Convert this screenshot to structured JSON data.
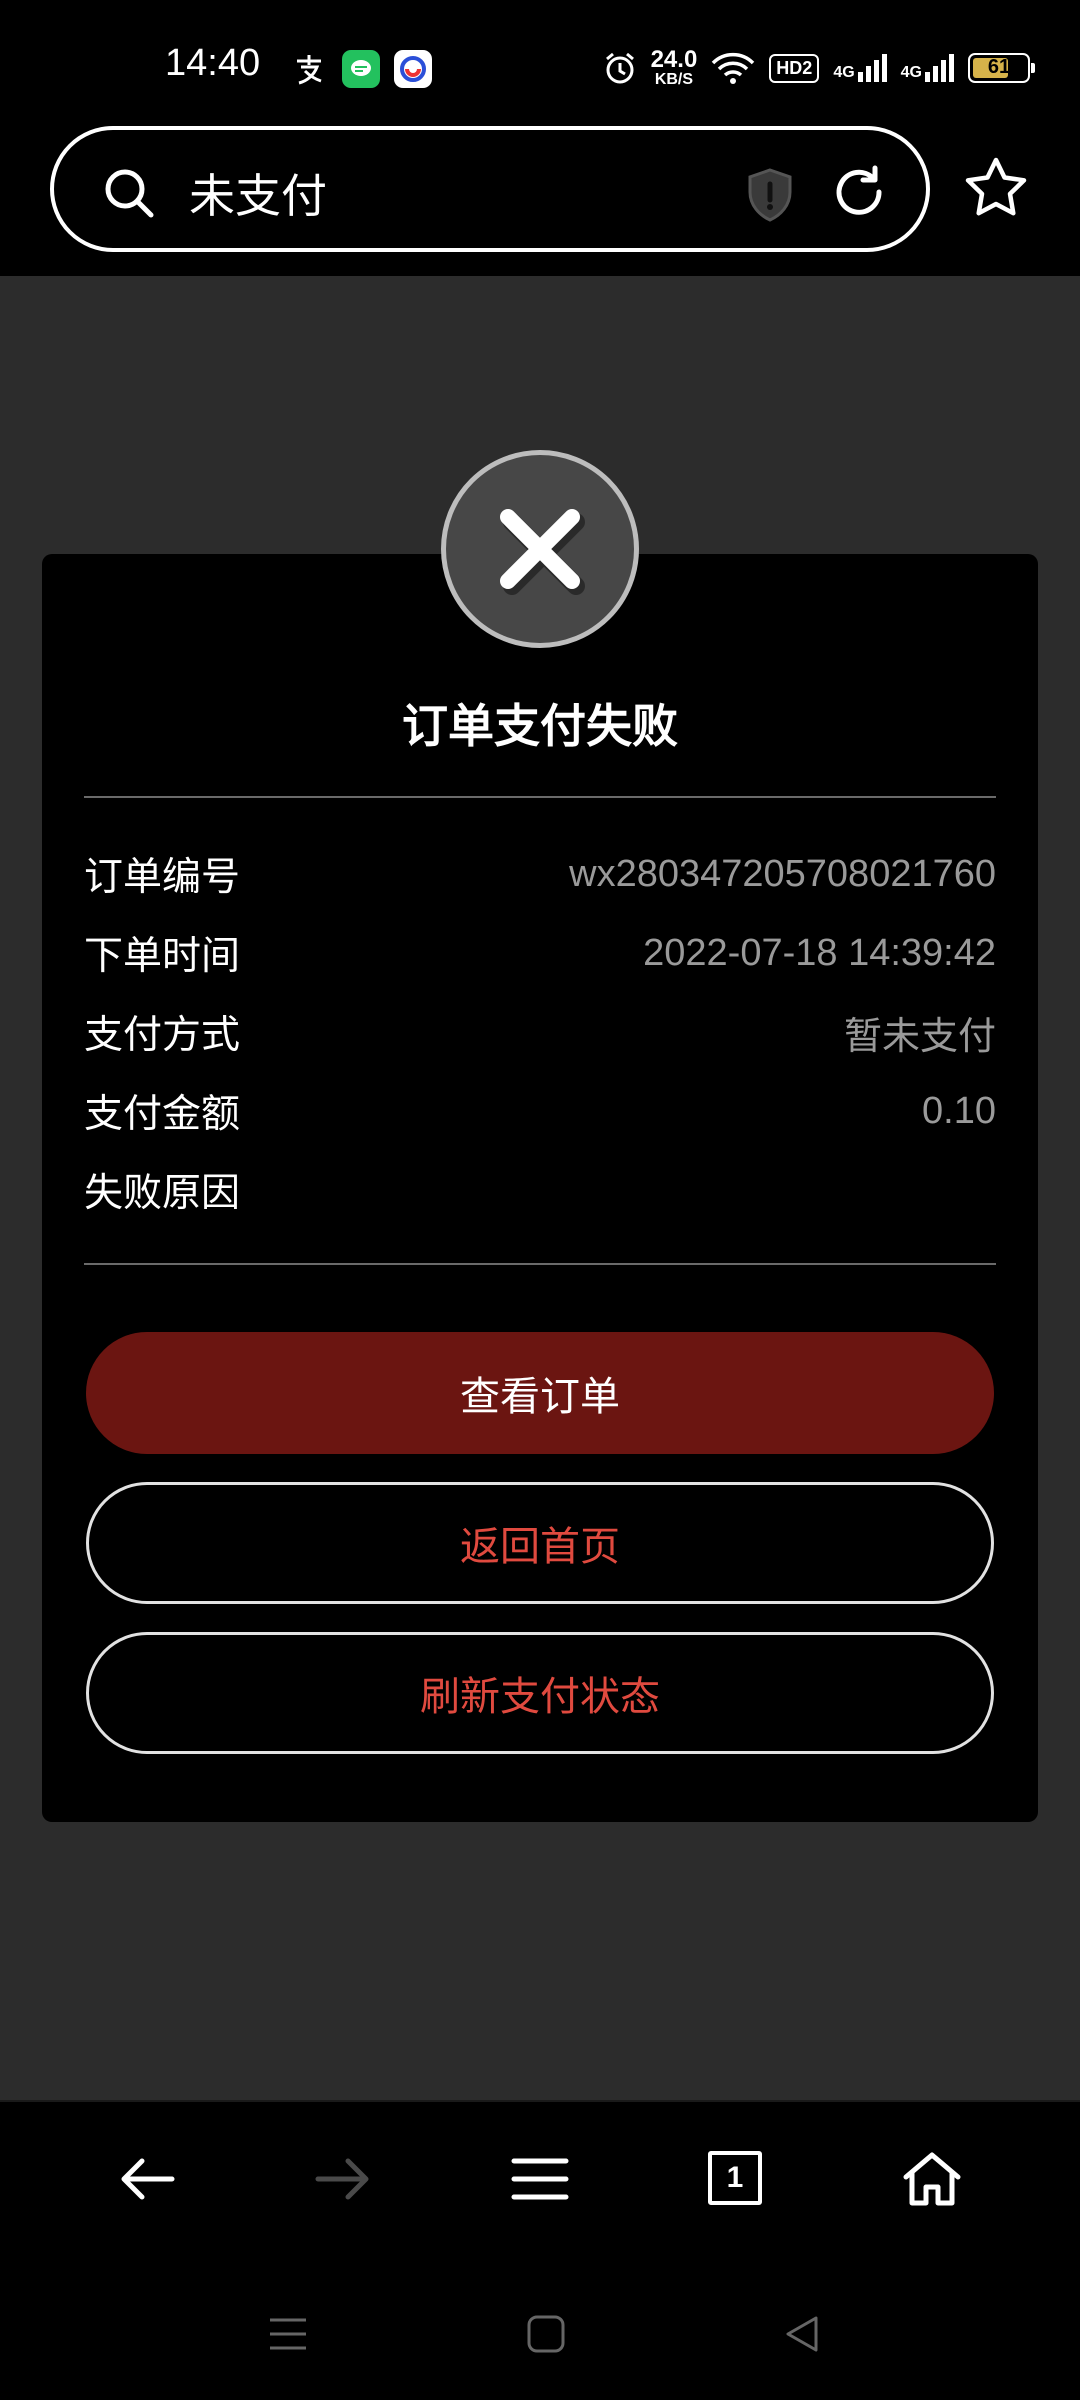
{
  "status_bar": {
    "time": "14:40",
    "net_speed": "24.0",
    "net_speed_unit": "KB/S",
    "hd_badge": "HD2",
    "net1": "4G",
    "net2": "4G",
    "battery": "61",
    "battery_color": "#d6b34a"
  },
  "address_bar": {
    "text": "未支付"
  },
  "card": {
    "title": "订单支付失败",
    "rows": [
      {
        "label": "订单编号",
        "value": "wx280347205708021760"
      },
      {
        "label": "下单时间",
        "value": "2022-07-18 14:39:42"
      },
      {
        "label": "支付方式",
        "value": "暂未支付"
      },
      {
        "label": "支付金额",
        "value": "0.10"
      },
      {
        "label": "失败原因",
        "value": ""
      }
    ],
    "buttons": {
      "view_order": "查看订单",
      "back_home": "返回首页",
      "refresh_status": "刷新支付状态"
    },
    "primary_color": "#6b1511",
    "accent_text_color": "#e04a3f"
  },
  "bottom_nav": {
    "tab_count": "1"
  }
}
